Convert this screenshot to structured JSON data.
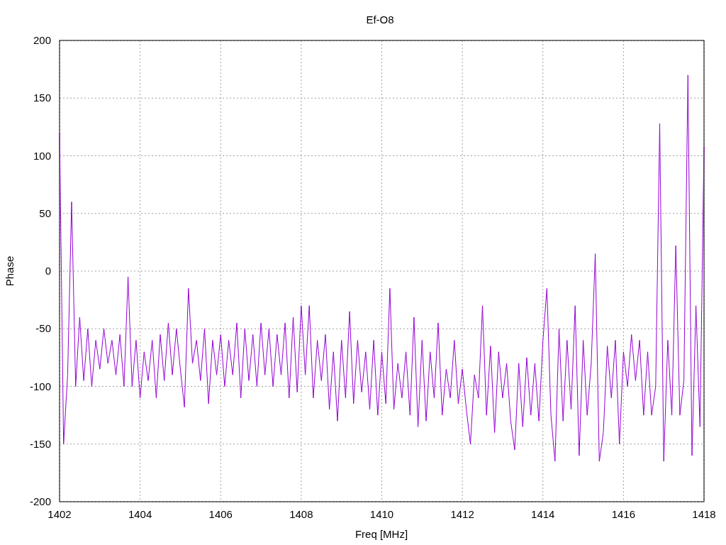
{
  "chart_data": {
    "type": "line",
    "grid": true,
    "title": "Ef-O8",
    "xlabel": "Freq [MHz]",
    "ylabel": "Phase",
    "xlim": [
      1402,
      1418
    ],
    "ylim": [
      -200,
      200
    ],
    "xticks": [
      1402,
      1404,
      1406,
      1408,
      1410,
      1412,
      1414,
      1416,
      1418
    ],
    "yticks": [
      -200,
      -150,
      -100,
      -50,
      0,
      50,
      100,
      150,
      200
    ],
    "x": [
      1402.0,
      1402.1,
      1402.2,
      1402.3,
      1402.4,
      1402.5,
      1402.6,
      1402.7,
      1402.8,
      1402.9,
      1403.0,
      1403.1,
      1403.2,
      1403.3,
      1403.4,
      1403.5,
      1403.6,
      1403.7,
      1403.8,
      1403.9,
      1404.0,
      1404.1,
      1404.2,
      1404.3,
      1404.4,
      1404.5,
      1404.6,
      1404.7,
      1404.8,
      1404.9,
      1405.0,
      1405.1,
      1405.2,
      1405.3,
      1405.4,
      1405.5,
      1405.6,
      1405.7,
      1405.8,
      1405.9,
      1406.0,
      1406.1,
      1406.2,
      1406.3,
      1406.4,
      1406.5,
      1406.6,
      1406.7,
      1406.8,
      1406.9,
      1407.0,
      1407.1,
      1407.2,
      1407.3,
      1407.4,
      1407.5,
      1407.6,
      1407.7,
      1407.8,
      1407.9,
      1408.0,
      1408.1,
      1408.2,
      1408.3,
      1408.4,
      1408.5,
      1408.6,
      1408.7,
      1408.8,
      1408.9,
      1409.0,
      1409.1,
      1409.2,
      1409.3,
      1409.4,
      1409.5,
      1409.6,
      1409.7,
      1409.8,
      1409.9,
      1410.0,
      1410.1,
      1410.2,
      1410.3,
      1410.4,
      1410.5,
      1410.6,
      1410.7,
      1410.8,
      1410.9,
      1411.0,
      1411.1,
      1411.2,
      1411.3,
      1411.4,
      1411.5,
      1411.6,
      1411.7,
      1411.8,
      1411.9,
      1412.0,
      1412.1,
      1412.2,
      1412.3,
      1412.4,
      1412.5,
      1412.6,
      1412.7,
      1412.8,
      1412.9,
      1413.0,
      1413.1,
      1413.2,
      1413.3,
      1413.4,
      1413.5,
      1413.6,
      1413.7,
      1413.8,
      1413.9,
      1414.0,
      1414.1,
      1414.2,
      1414.3,
      1414.4,
      1414.5,
      1414.6,
      1414.7,
      1414.8,
      1414.9,
      1415.0,
      1415.1,
      1415.2,
      1415.3,
      1415.4,
      1415.5,
      1415.6,
      1415.7,
      1415.8,
      1415.9,
      1416.0,
      1416.1,
      1416.2,
      1416.3,
      1416.4,
      1416.5,
      1416.6,
      1416.7,
      1416.8,
      1416.9,
      1417.0,
      1417.1,
      1417.2,
      1417.3,
      1417.4,
      1417.5,
      1417.6,
      1417.7,
      1417.8,
      1417.9,
      1418.0
    ],
    "series": [
      {
        "color": "#9400d3",
        "values": [
          120,
          -150,
          -90,
          60,
          -100,
          -40,
          -95,
          -50,
          -100,
          -60,
          -85,
          -50,
          -80,
          -60,
          -90,
          -55,
          -100,
          -5,
          -100,
          -60,
          -110,
          -70,
          -95,
          -60,
          -110,
          -55,
          -95,
          -45,
          -90,
          -50,
          -85,
          -118,
          -15,
          -80,
          -60,
          -95,
          -50,
          -115,
          -60,
          -90,
          -55,
          -100,
          -60,
          -90,
          -45,
          -110,
          -50,
          -95,
          -55,
          -100,
          -45,
          -90,
          -50,
          -100,
          -55,
          -90,
          -45,
          -110,
          -40,
          -105,
          -30,
          -90,
          -30,
          -110,
          -60,
          -95,
          -55,
          -120,
          -70,
          -130,
          -60,
          -110,
          -35,
          -115,
          -60,
          -105,
          -70,
          -120,
          -60,
          -125,
          -70,
          -115,
          -15,
          -120,
          -80,
          -110,
          -70,
          -125,
          -40,
          -135,
          -60,
          -130,
          -70,
          -110,
          -45,
          -125,
          -85,
          -110,
          -60,
          -115,
          -85,
          -120,
          -150,
          -90,
          -110,
          -30,
          -125,
          -65,
          -140,
          -70,
          -110,
          -80,
          -130,
          -155,
          -80,
          -135,
          -75,
          -125,
          -80,
          -130,
          -60,
          -15,
          -125,
          -165,
          -50,
          -130,
          -60,
          -120,
          -30,
          -160,
          -60,
          -125,
          -80,
          15,
          -165,
          -140,
          -65,
          -110,
          -60,
          -150,
          -70,
          -100,
          -55,
          -95,
          -60,
          -125,
          -70,
          -125,
          -100,
          128,
          -165,
          -60,
          -125,
          22,
          -125,
          -95,
          170,
          -160,
          -30,
          -135,
          108
        ]
      }
    ]
  }
}
